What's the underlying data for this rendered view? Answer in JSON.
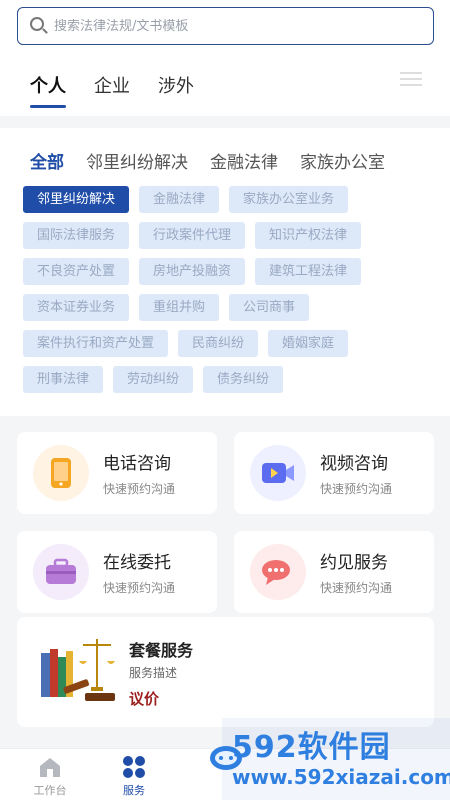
{
  "search": {
    "placeholder": "搜索法律法规/文书模板"
  },
  "tabs": [
    "个人",
    "企业",
    "涉外"
  ],
  "subtabs": [
    "全部",
    "邻里纠纷解决",
    "金融法律",
    "家族办公室"
  ],
  "chips": [
    [
      "邻里纠纷解决",
      "金融法律",
      "家族办公室业务"
    ],
    [
      "国际法律服务",
      "行政案件代理",
      "知识产权法律"
    ],
    [
      "不良资产处置",
      "房地产投融资",
      "建筑工程法律"
    ],
    [
      "资本证券业务",
      "重组并购",
      "公司商事"
    ],
    [
      "案件执行和资产处置",
      "民商纠纷",
      "婚姻家庭"
    ],
    [
      "刑事法律",
      "劳动纠纷",
      "债务纠纷"
    ]
  ],
  "services": [
    {
      "title": "电话咨询",
      "sub": "快速预约沟通",
      "icon": "phone-icon"
    },
    {
      "title": "视频咨询",
      "sub": "快速预约沟通",
      "icon": "video-icon"
    },
    {
      "title": "在线委托",
      "sub": "快速预约沟通",
      "icon": "briefcase-icon"
    },
    {
      "title": "约见服务",
      "sub": "快速预约沟通",
      "icon": "chat-icon"
    }
  ],
  "package": {
    "title": "套餐服务",
    "desc": "服务描述",
    "price": "议价"
  },
  "bottom_nav": {
    "work": "工作台",
    "service": "服务"
  },
  "watermark": {
    "brand": "592软件园",
    "url": "www.592xiazai.com"
  },
  "colors": {
    "accent": "#1f4da8",
    "chip_bg": "#dde8f8",
    "price": "#9c1f1f"
  }
}
